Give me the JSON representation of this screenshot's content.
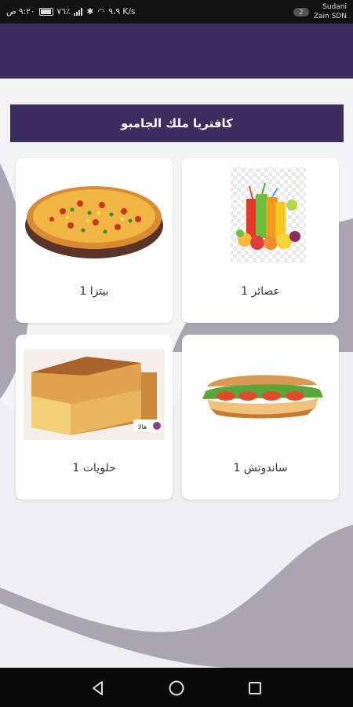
{
  "status_bar": {
    "time": "٩:٢٠ ص",
    "net_speed": "٩،٩ K/s",
    "battery": "٧٦٪",
    "carrier_line1": "Sudani",
    "carrier_line2": "Zain SDN",
    "sim_badge": "2"
  },
  "header": {
    "title": "كافتريا ملك الجامبو"
  },
  "categories": [
    {
      "label": "عصائر 1",
      "icon": "juice-image"
    },
    {
      "label": "بيتزا 1",
      "icon": "pizza-image"
    },
    {
      "label": "ساندوتش 1",
      "icon": "sandwich-image"
    },
    {
      "label": "حلويات 1",
      "icon": "basbousa-image"
    }
  ],
  "watermark": "هالا",
  "nav": {
    "back": "back-icon",
    "home": "home-icon",
    "recents": "recents-icon"
  },
  "colors": {
    "primary": "#3d2c5e",
    "background": "#efeff2",
    "card": "#ffffff"
  }
}
